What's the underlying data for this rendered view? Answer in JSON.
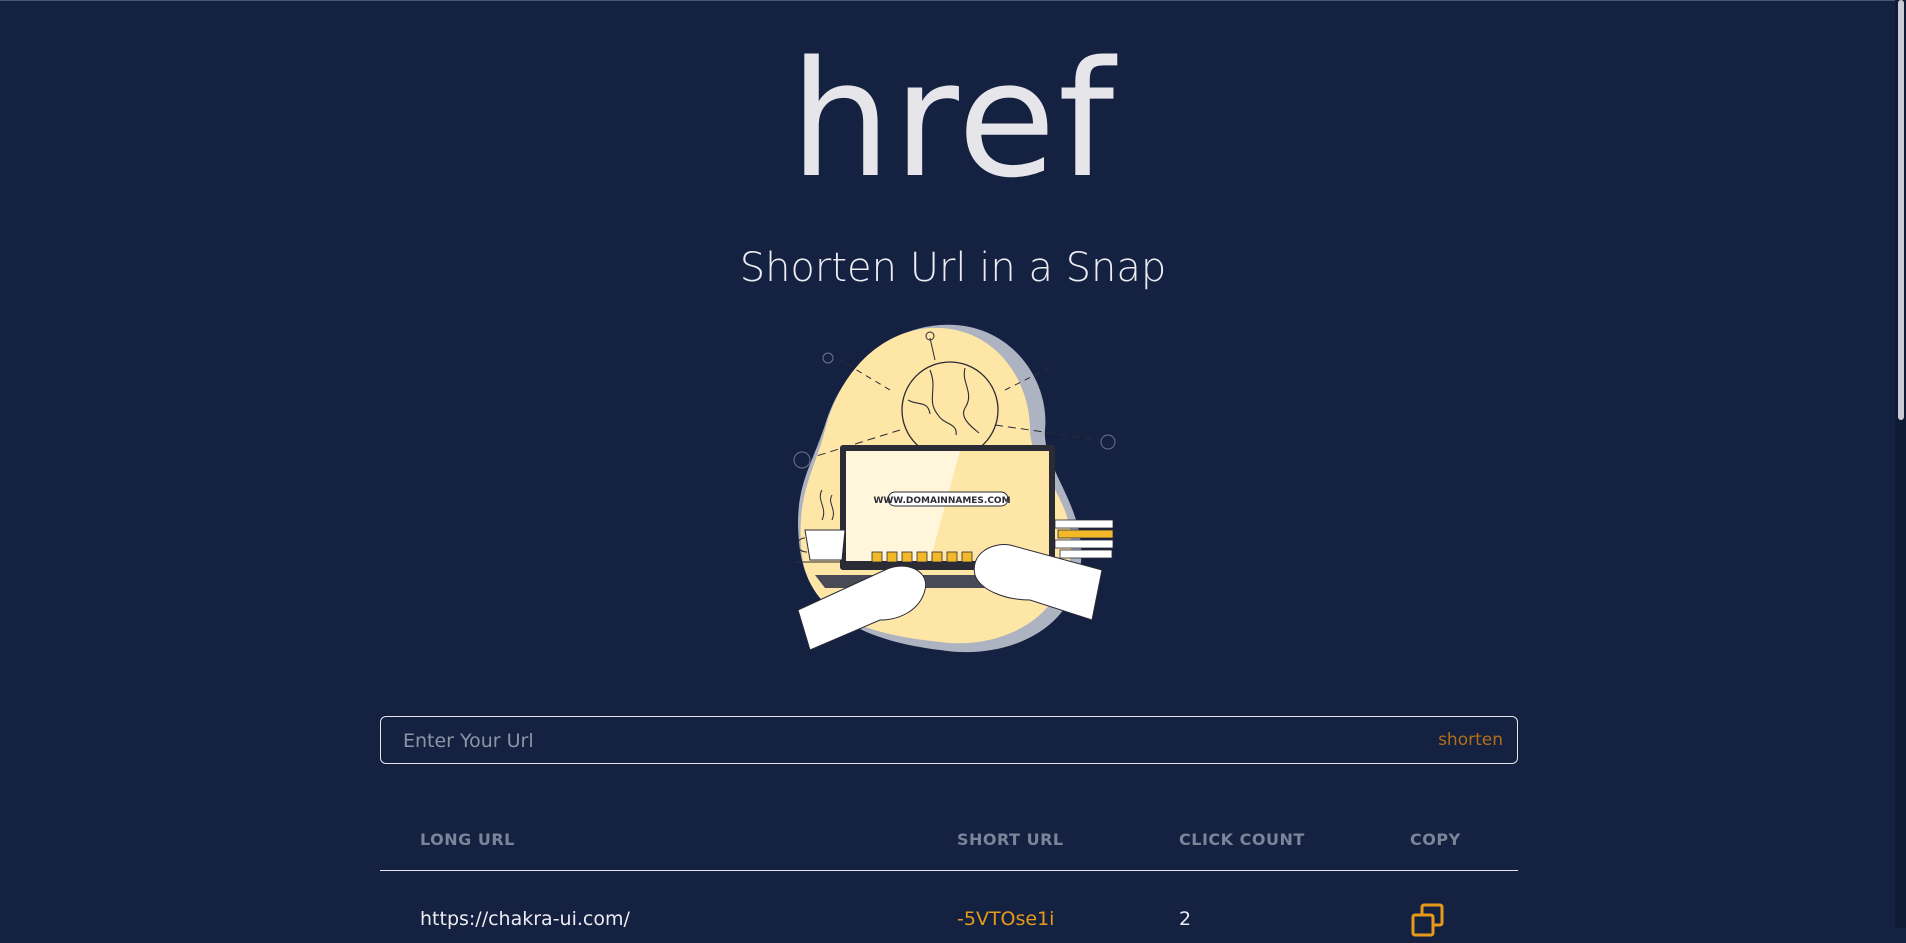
{
  "app": {
    "logo": "href",
    "subtitle": "Shorten Url in a Snap",
    "accent_color": "#e79a1a",
    "background_color": "#142141"
  },
  "hero_image": {
    "icon": "laptop-globe-illustration",
    "text": "WWW.DOMAINNAMES.COM"
  },
  "search": {
    "placeholder": "Enter Your Url",
    "value": "",
    "button_label": "shorten"
  },
  "table": {
    "headers": [
      "LONG URL",
      "SHORT URL",
      "CLICK COUNT",
      "COPY"
    ],
    "rows": [
      {
        "long_url": "https://chakra-ui.com/",
        "short_url": "-5VTOse1i",
        "click_count": "2",
        "copy_icon": "copy-icon"
      }
    ]
  }
}
